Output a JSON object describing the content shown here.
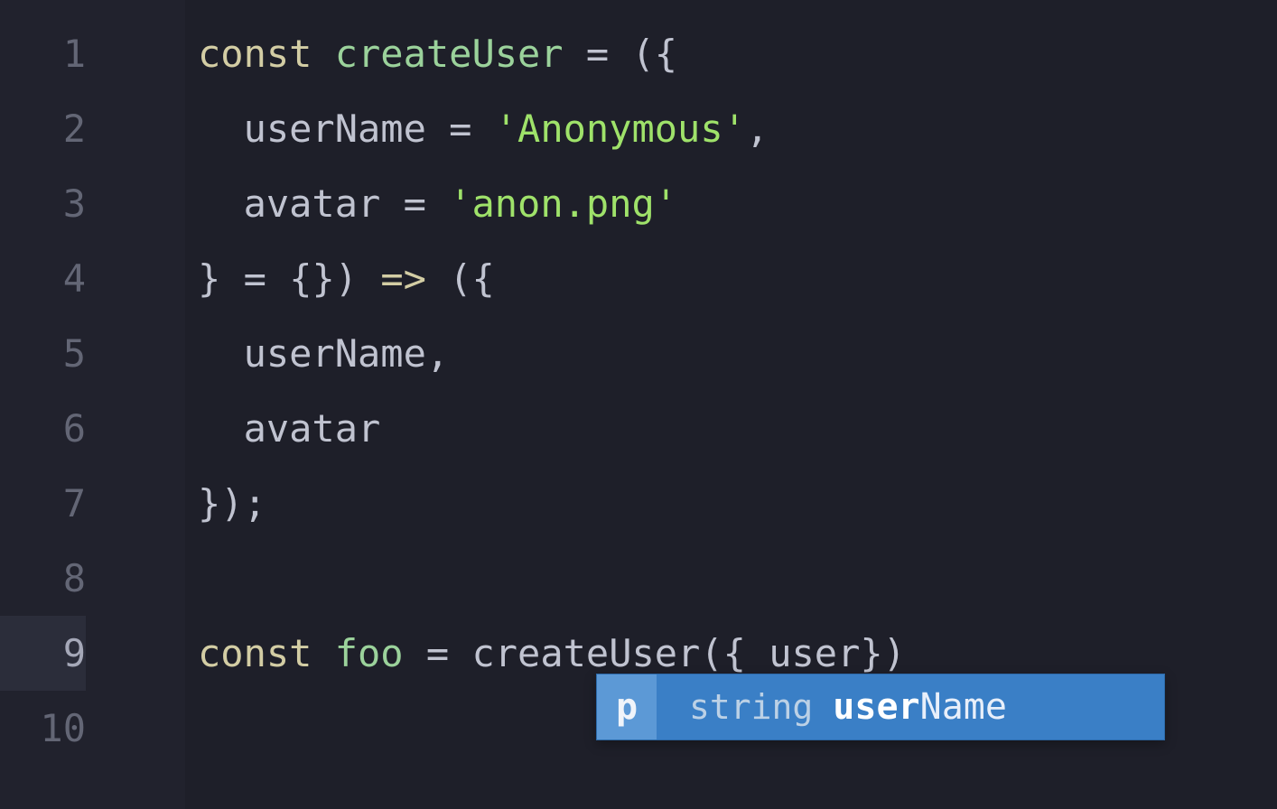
{
  "gutter": {
    "lines": [
      "1",
      "2",
      "3",
      "4",
      "5",
      "6",
      "7",
      "8",
      "9",
      "10"
    ],
    "active_index": 8
  },
  "code": {
    "l1": {
      "kw": "const",
      "sp1": " ",
      "fn": "createUser",
      "sp2": " ",
      "eq": "=",
      "sp3": " ",
      "rest": "({"
    },
    "l2": {
      "indent": "  ",
      "name": "userName",
      "sp1": " ",
      "eq": "=",
      "sp2": " ",
      "str": "'Anonymous'",
      "comma": ","
    },
    "l3": {
      "indent": "  ",
      "name": "avatar",
      "sp1": " ",
      "eq": "=",
      "sp2": " ",
      "str": "'anon.png'"
    },
    "l4": {
      "close": "}",
      "sp1": " ",
      "eq": "=",
      "sp2": " ",
      "empty": "{}",
      "paren": ")",
      "sp3": " ",
      "arrow": "=>",
      "sp4": " ",
      "rest": "({"
    },
    "l5": {
      "indent": "  ",
      "name": "userName",
      "comma": ","
    },
    "l6": {
      "indent": "  ",
      "name": "avatar"
    },
    "l7": {
      "text": "});"
    },
    "l8": {
      "text": ""
    },
    "l9": {
      "kw": "const",
      "sp1": " ",
      "var": "foo",
      "sp2": " ",
      "eq": "=",
      "sp3": " ",
      "fn": "createUser",
      "args": "({ user})"
    },
    "l10": {
      "text": ""
    }
  },
  "suggest": {
    "icon": "p",
    "type": "string",
    "match": "user",
    "rest": "Name"
  }
}
